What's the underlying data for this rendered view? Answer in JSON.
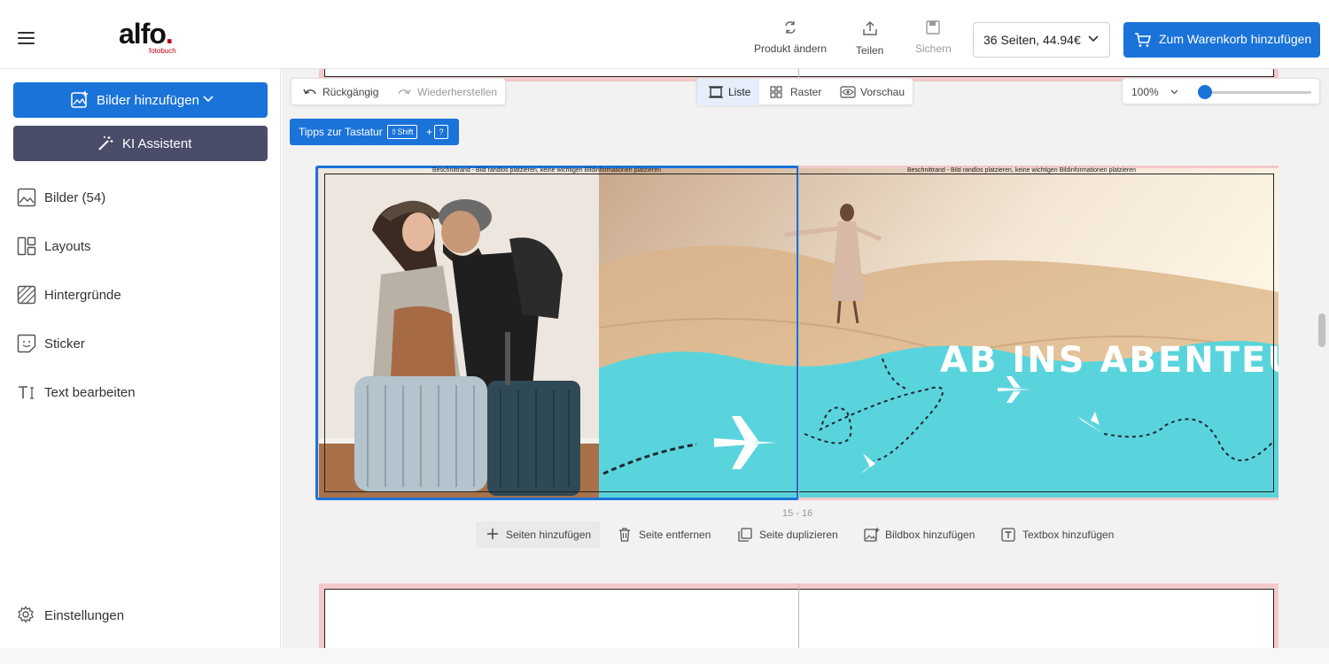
{
  "header": {
    "logo": {
      "main": "alfo",
      "sub": "fotobuch"
    },
    "actions": {
      "change_product": "Produkt ändern",
      "share": "Teilen",
      "save": "Sichern"
    },
    "pages_select": "36 Seiten, 44.94€",
    "cart_button": "Zum Warenkorb hinzufügen"
  },
  "sidebar": {
    "add_images": "Bilder hinzufügen",
    "ai_assistant": "KI Assistent",
    "items": [
      {
        "label": "Bilder (54)",
        "icon": "image-icon"
      },
      {
        "label": "Layouts",
        "icon": "layout-icon"
      },
      {
        "label": "Hintergründe",
        "icon": "background-icon"
      },
      {
        "label": "Sticker",
        "icon": "sticker-icon"
      },
      {
        "label": "Text bearbeiten",
        "icon": "text-icon"
      }
    ],
    "settings": "Einstellungen"
  },
  "toolbar": {
    "undo": "Rückgängig",
    "redo": "Wiederherstellen",
    "views": {
      "list": "Liste",
      "grid": "Raster",
      "preview": "Vorschau"
    },
    "active_view": "list",
    "zoom": "100%",
    "zoom_level": 0
  },
  "tips": {
    "label": "Tipps zur Tastatur",
    "key_shift": "⇧Shift",
    "plus": "+",
    "key_q": "?"
  },
  "spread": {
    "page_range": "15 - 16",
    "bleed_note": "Beschnittrand - Bild randlos platzieren, keine wichtigen Bildinformationen platzieren",
    "headline": "AB INS ABENTEUER!"
  },
  "page_actions": {
    "add_pages": "Seiten hinzufügen",
    "remove_page": "Seite entfernen",
    "duplicate_page": "Seite duplizieren",
    "add_image_box": "Bildbox hinzufügen",
    "add_text_box": "Textbox hinzufügen"
  },
  "colors": {
    "primary": "#1a73d9",
    "ki_button": "#4a4d69",
    "turquoise": "#5ad4dc",
    "bleed": "#f3c9c9"
  }
}
